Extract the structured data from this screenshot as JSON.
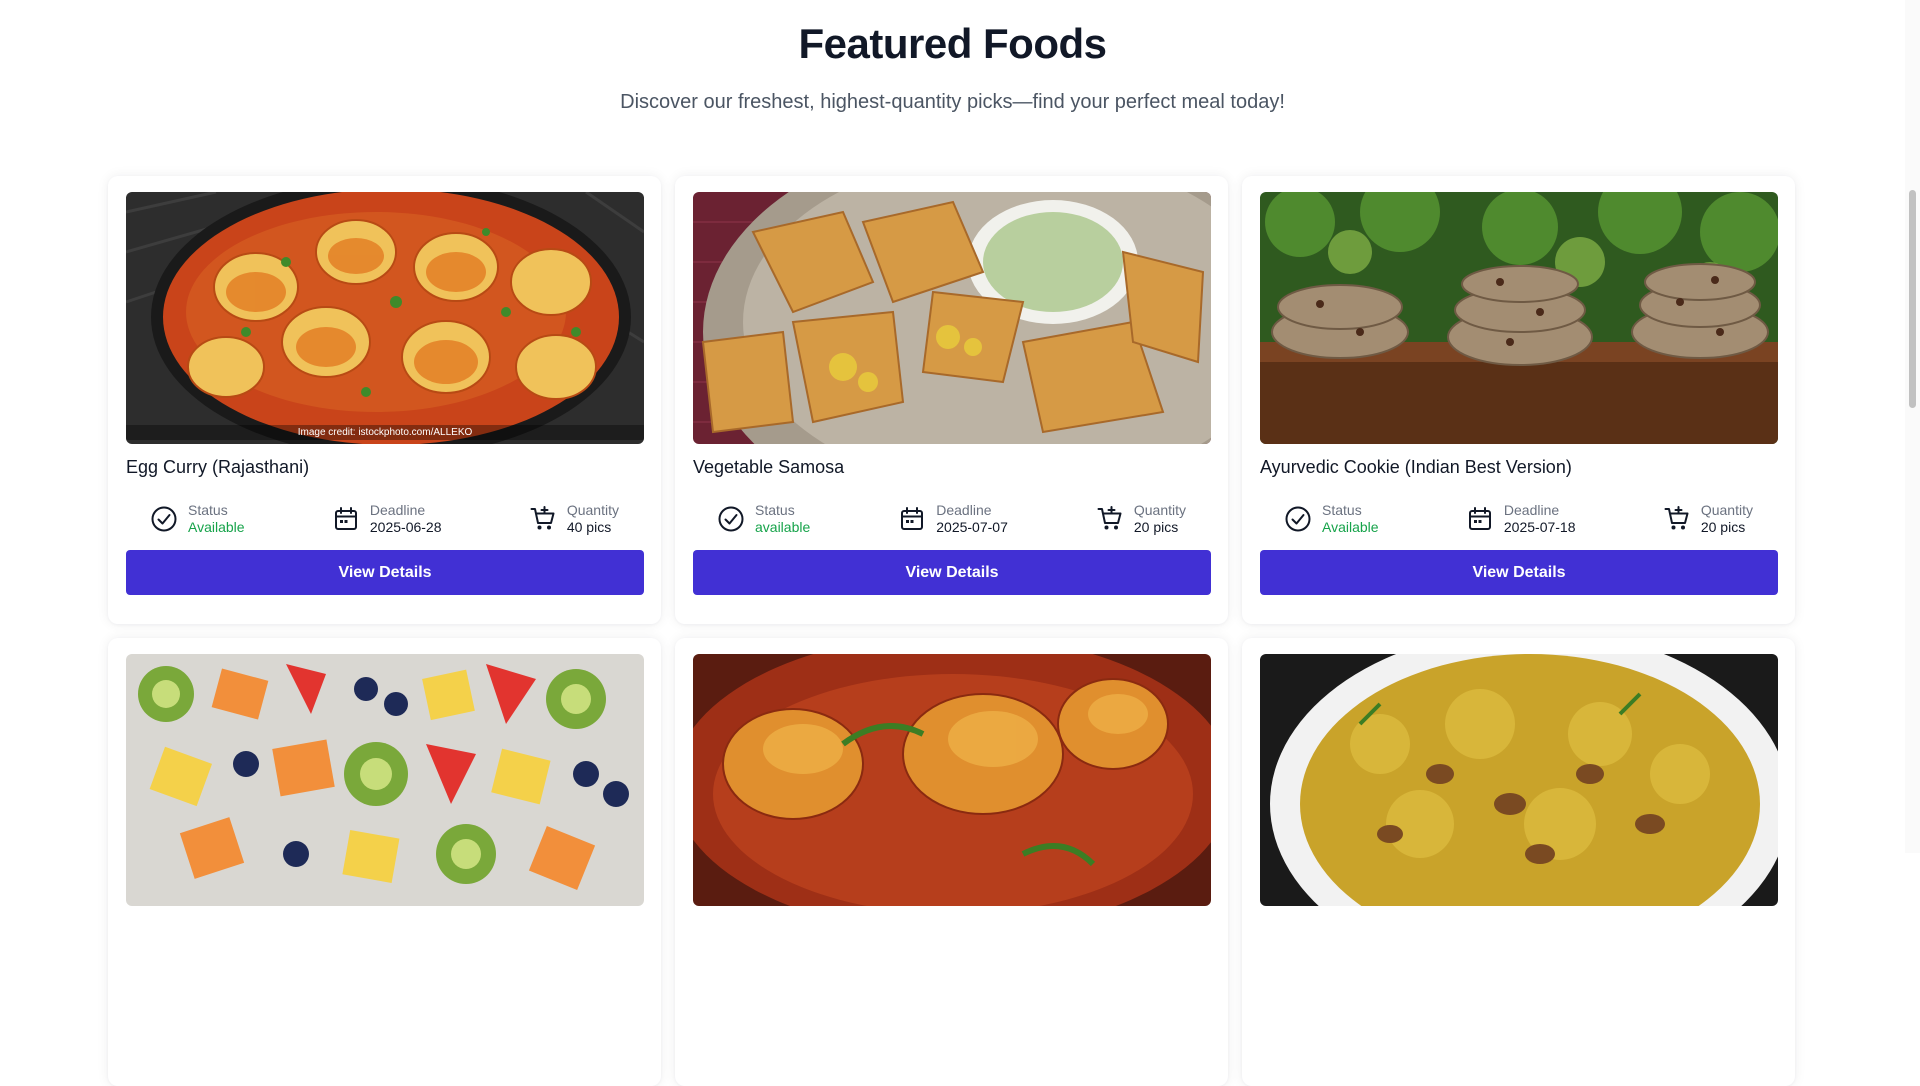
{
  "header": {
    "title": "Featured Foods",
    "subtitle": "Discover our freshest, highest-quantity picks—find your perfect meal today!"
  },
  "meta_labels": {
    "status": "Status",
    "deadline": "Deadline",
    "quantity": "Quantity"
  },
  "button_label": "View Details",
  "foods": [
    {
      "name": "Egg Curry (Rajasthani)",
      "status": "Available",
      "deadline": "2025-06-28",
      "quantity": "40 pics",
      "image_credit": "Image credit: istockphoto.com/ALLEKO"
    },
    {
      "name": "Vegetable Samosa",
      "status": "available",
      "deadline": "2025-07-07",
      "quantity": "20 pics"
    },
    {
      "name": "Ayurvedic Cookie (Indian Best Version)",
      "status": "Available",
      "deadline": "2025-07-18",
      "quantity": "20 pics"
    }
  ],
  "colors": {
    "accent": "#4130d4",
    "status_green": "#16a34a"
  },
  "icons": [
    "check-circle-icon",
    "calendar-icon",
    "cart-icon"
  ]
}
